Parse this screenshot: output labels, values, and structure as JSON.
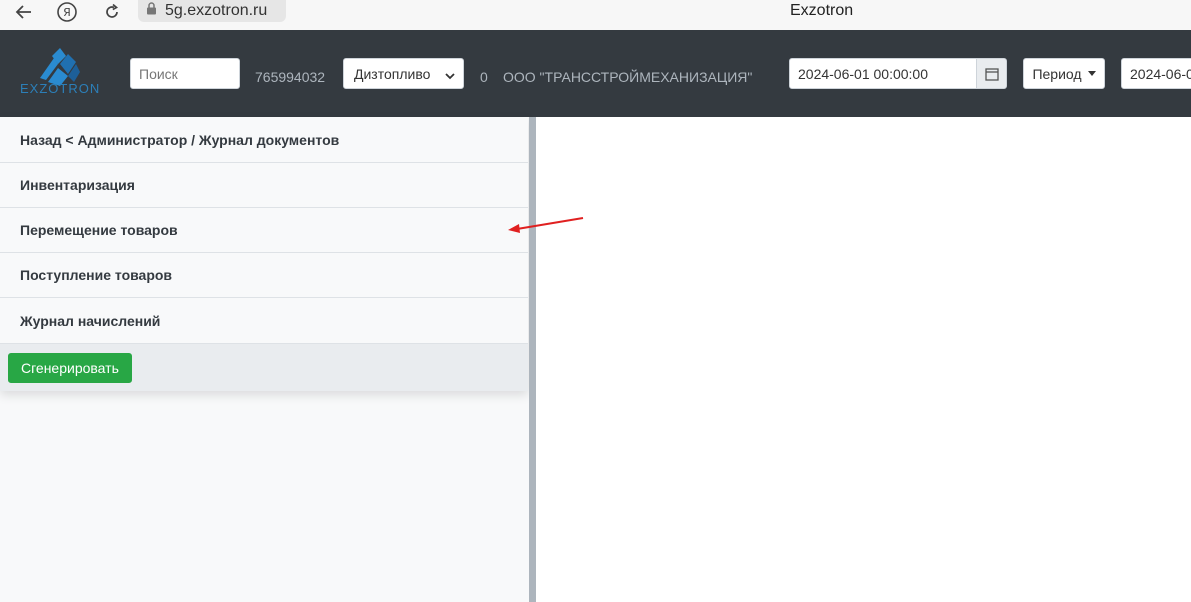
{
  "browser": {
    "url": "5g.exzotron.ru",
    "tab_title": "Exzotron"
  },
  "header": {
    "logo_text": "EXZOTRON",
    "search_placeholder": "Поиск",
    "account_id": "765994032",
    "fuel_select": "Дизтопливо",
    "count": "0",
    "company": "ООО \"ТРАНССТРОЙМЕХАНИЗАЦИЯ\"",
    "date_from": "2024-06-01 00:00:00",
    "period_label": "Период",
    "date_to": "2024-06-0"
  },
  "sidebar": {
    "breadcrumb": "Назад < Администратор / Журнал документов",
    "items": [
      {
        "label": "Инвентаризация"
      },
      {
        "label": "Перемещение товаров"
      },
      {
        "label": "Поступление товаров"
      },
      {
        "label": "Журнал начислений"
      }
    ],
    "generate_label": "Сгенерировать"
  },
  "colors": {
    "header_bg": "#343a40",
    "accent_green": "#28a745",
    "annotation_arrow": "#e02020"
  }
}
